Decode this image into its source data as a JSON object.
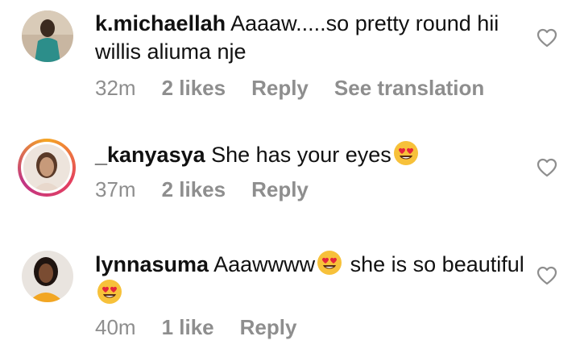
{
  "comments": [
    {
      "username": "k.michaellah",
      "text": "Aaaaw.....so pretty round hii willis aliuma nje",
      "time": "32m",
      "likes": "2 likes",
      "reply": "Reply",
      "translate": "See translation",
      "avatar_icon": "user-photo-avatar"
    },
    {
      "username": "_kanyasya",
      "text_before": "She has your eyes",
      "time": "37m",
      "likes": "2 likes",
      "reply": "Reply",
      "avatar_icon": "story-ring-avatar"
    },
    {
      "username": "lynnasuma",
      "text_before": "Aaawwww",
      "text_middle": " she is so beautiful ",
      "time": "40m",
      "likes": "1 like",
      "reply": "Reply",
      "avatar_icon": "user-photo-avatar"
    }
  ],
  "icons": {
    "like": "heart-outline-icon",
    "emoji": "heart-eyes-emoji"
  }
}
